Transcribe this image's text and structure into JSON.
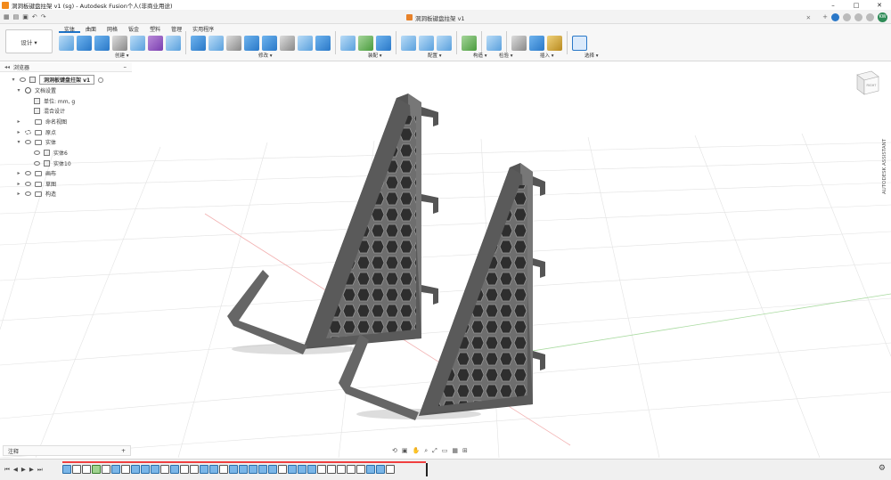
{
  "titlebar": {
    "title": "洞洞板键盘拄架 v1 (sg) - Autodesk Fusion个人(非商业用途)",
    "controls": [
      "–",
      "□",
      "✕"
    ]
  },
  "appbar": {
    "doc_tab": "洞洞板键盘拄架 v1",
    "close": "✕",
    "avatar": "KW"
  },
  "ribbon": {
    "design_button": "设计 ▾",
    "tabs": [
      "实体",
      "曲面",
      "网格",
      "钣金",
      "塑料",
      "管理",
      "实用程序"
    ],
    "groups": {
      "create": "创建 ▾",
      "modify": "修改 ▾",
      "assemble": "装配 ▾",
      "configure": "配置 ▾",
      "construct": "构造 ▾",
      "inspect": "检验 ▾",
      "insert": "插入 ▾",
      "select": "选择 ▾"
    }
  },
  "browser": {
    "title": "浏览器",
    "root": "洞洞板键盘拄架 v1",
    "items": [
      {
        "label": "文档设置"
      },
      {
        "label": "单位: mm, g"
      },
      {
        "label": "混合设计"
      },
      {
        "label": "命名视图"
      },
      {
        "label": "原点"
      },
      {
        "label": "实体"
      },
      {
        "label": "实体6"
      },
      {
        "label": "实体10"
      },
      {
        "label": "画布"
      },
      {
        "label": "草图"
      },
      {
        "label": "构造"
      }
    ]
  },
  "assistant": "AUTODESK ASSISTANT",
  "viewcube_label": "RIGHT",
  "comments": {
    "label": "注释",
    "plus": "+"
  },
  "colors": {
    "accent": "#1d74c9",
    "model": "#5e5e5e",
    "timeline_progress": "#f04040"
  }
}
